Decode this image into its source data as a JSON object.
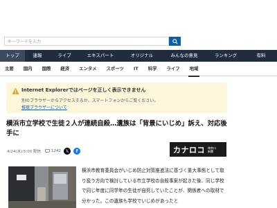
{
  "search": {
    "placeholder": "キーワードを入力"
  },
  "global_nav": [
    {
      "label": "トップ",
      "active": true
    },
    {
      "label": "速報",
      "active": false
    },
    {
      "label": "ライブ",
      "active": false
    },
    {
      "label": "エキスパート",
      "active": false
    },
    {
      "label": "オリジナル",
      "active": false
    },
    {
      "label": "みんなの意見",
      "active": false
    },
    {
      "label": "ランキング",
      "active": false
    },
    {
      "label": "有料",
      "active": false
    }
  ],
  "category_nav": [
    {
      "label": "主要",
      "active": false
    },
    {
      "label": "国内",
      "active": false
    },
    {
      "label": "国際",
      "active": false
    },
    {
      "label": "経済",
      "active": false
    },
    {
      "label": "エンタメ",
      "active": false
    },
    {
      "label": "スポーツ",
      "active": false
    },
    {
      "label": "IT",
      "active": false
    },
    {
      "label": "科学",
      "active": false
    },
    {
      "label": "ライフ",
      "active": false
    },
    {
      "label": "地域",
      "active": true
    }
  ],
  "notice": {
    "title": "Internet Explorerではページを正しく表示できません",
    "desc": "別のブラウザーからアクセスするか、スマートフォンからご覧ください。",
    "link": "推奨ブラウザーについて"
  },
  "article": {
    "headline": "横浜市立学校で生徒２人が連続自殺…遺族は「背景にいじめ」訴え、対応後手に",
    "date": "4/24(水) 5:00 配信",
    "comment_count": "1242",
    "source_logo": {
      "main": "カナロコ",
      "sub": "神奈川新聞"
    },
    "body": "横浜市教育委員会がいじめ防止対策推進法に基づく重大事態として取り扱う方向で検討している市立学校の自殺事案が起きた後、同じ学校で同じ年度に同学年の生徒が自死していたことが、関係者への取材で分かった。この遺族も学校でいじめがあったと"
  },
  "colors": {
    "nav_bg": "#1f2d3f",
    "notice_bg": "#fdf6db",
    "link": "#1a5fb4",
    "x_share": "#000000",
    "facebook_share": "#1877f2"
  }
}
